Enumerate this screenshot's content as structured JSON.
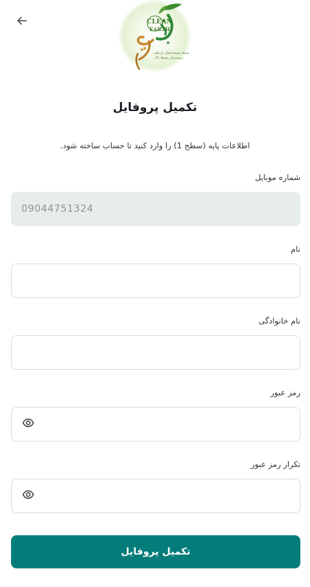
{
  "header": {
    "back_icon": "arrow-left-icon",
    "logo": {
      "brand_line1": "CLEAN",
      "brand_line2": "EARTH",
      "tagline": "شبکه پسماندهای بازیافت",
      "tagline2": "زمینه‌ساز محیط پاک"
    }
  },
  "page": {
    "title": "تکمیل پروفایل",
    "subtitle": "اطلاعات پایه (سطح 1) را وارد کنید تا حساب ساخته شود."
  },
  "form": {
    "mobile": {
      "label": "شماره موبایل",
      "value": "09044751324"
    },
    "first_name": {
      "label": "نام",
      "value": ""
    },
    "last_name": {
      "label": "نام خانوادگی",
      "value": ""
    },
    "password": {
      "label": "رمز عبور",
      "value": "",
      "toggle_icon": "eye-icon"
    },
    "password_confirm": {
      "label": "تکرار رمز عبور",
      "value": "",
      "toggle_icon": "eye-icon"
    },
    "submit_label": "تکمیل پروفایل"
  },
  "colors": {
    "primary": "#047d7a",
    "disabled_field": "#e7edeb",
    "border": "#d8dde2"
  }
}
